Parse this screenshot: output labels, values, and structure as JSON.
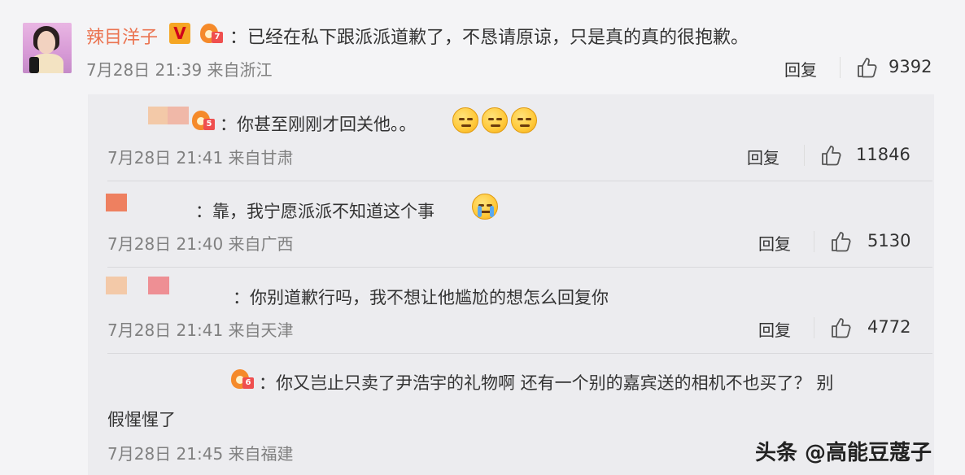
{
  "main_comment": {
    "author": "辣目洋子",
    "level": "7",
    "text": "：已经在私下跟派派道歉了，不恳请原谅，只是真的真的很抱歉。",
    "time": "7月28日 21:39 来自浙江",
    "reply_label": "回复",
    "likes": "9392"
  },
  "replies": [
    {
      "level": "5",
      "text": "：你甚至刚刚才回关他。。",
      "time": "7月28日 21:41 来自甘肃",
      "reply_label": "回复",
      "likes": "11846",
      "emojis": [
        "dull-face-emoji",
        "dull-face-emoji",
        "dull-face-emoji"
      ]
    },
    {
      "text": "：靠，我宁愿派派不知道这个事",
      "time": "7月28日 21:40 来自广西",
      "reply_label": "回复",
      "likes": "5130",
      "emojis": [
        "crying-face-emoji"
      ]
    },
    {
      "text": "：你别道歉行吗，我不想让他尴尬的想怎么回复你",
      "time": "7月28日 21:41 来自天津",
      "reply_label": "回复",
      "likes": "4772"
    },
    {
      "level": "6",
      "text_line1": "：你又岂止只卖了尹浩宇的礼物啊 还有一个别的嘉宾送的相机不也买了？ 别",
      "text_line2": "假惺惺了",
      "time": "7月28日 21:45 来自福建"
    }
  ],
  "watermark": "头条 @高能豆蔻子",
  "colors": {
    "author_name": "#eb7350",
    "meta_text": "#808080",
    "reply_background": "#ececef"
  }
}
